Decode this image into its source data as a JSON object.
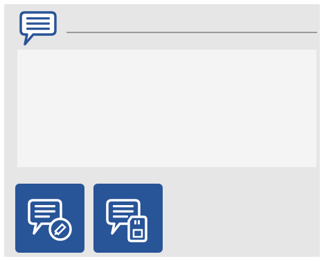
{
  "panel": {
    "header_icon": "speech-bubble-lines-icon",
    "notes": {
      "value": "",
      "placeholder": ""
    }
  },
  "actions": {
    "edit_icon": "speech-bubble-pencil-icon",
    "save_icon": "speech-bubble-sd-card-icon"
  },
  "colors": {
    "accent": "#285498",
    "panel_bg": "#e6e6e6",
    "notes_bg": "#f4f4f4",
    "divider": "#9a9a9a",
    "icon_fill": "#ffffff"
  }
}
